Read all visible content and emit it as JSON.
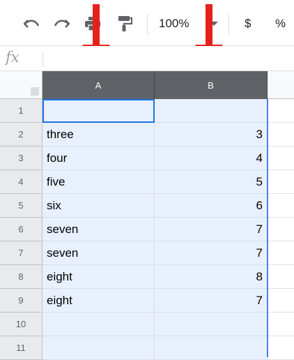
{
  "toolbar": {
    "zoom_label": "100%",
    "currency_label": "$",
    "percent_label": "%"
  },
  "formula_bar": {
    "fx_label": "fx",
    "value": ""
  },
  "grid": {
    "columns": [
      "A",
      "B"
    ],
    "rows": [
      {
        "num": "1",
        "a": "",
        "b": ""
      },
      {
        "num": "2",
        "a": "three",
        "b": "3"
      },
      {
        "num": "3",
        "a": "four",
        "b": "4"
      },
      {
        "num": "4",
        "a": "five",
        "b": "5"
      },
      {
        "num": "5",
        "a": "six",
        "b": "6"
      },
      {
        "num": "6",
        "a": "seven",
        "b": "7"
      },
      {
        "num": "7",
        "a": "seven",
        "b": "7"
      },
      {
        "num": "8",
        "a": "eight",
        "b": "8"
      },
      {
        "num": "9",
        "a": "eight",
        "b": "7"
      },
      {
        "num": "10",
        "a": "",
        "b": ""
      },
      {
        "num": "11",
        "a": "",
        "b": ""
      }
    ]
  },
  "colors": {
    "selection_fill": "#e8f0fe",
    "selection_border": "#1a73e8",
    "header_selected": "#5f6368",
    "annotation_arrow": "#e8201d"
  },
  "icons": [
    "undo-icon",
    "redo-icon",
    "print-icon",
    "paint-format-icon",
    "chevron-down-icon",
    "down-arrow-annotation"
  ]
}
